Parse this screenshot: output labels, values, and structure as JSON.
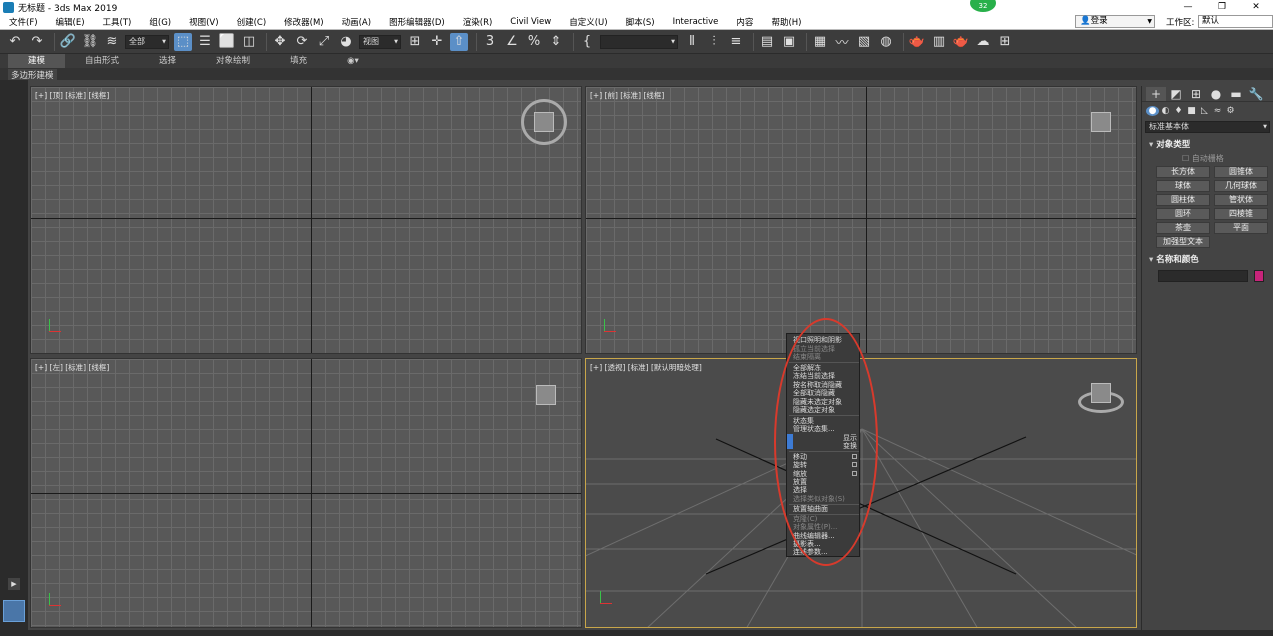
{
  "window": {
    "title": "无标题 - 3ds Max 2019",
    "notification_count": "32",
    "controls": [
      "—",
      "❐",
      "✕"
    ]
  },
  "menubar": {
    "items": [
      "文件(F)",
      "编辑(E)",
      "工具(T)",
      "组(G)",
      "视图(V)",
      "创建(C)",
      "修改器(M)",
      "动画(A)",
      "图形编辑器(D)",
      "渲染(R)",
      "Civil View",
      "自定义(U)",
      "脚本(S)",
      "Interactive",
      "内容",
      "帮助(H)"
    ],
    "login": "登录",
    "workspace_label": "工作区:",
    "workspace_value": "默认"
  },
  "toolbar": {
    "selection_filter": "全部",
    "ref_coord": "视图",
    "named_selection": ""
  },
  "ribbon": {
    "tabs": [
      "建模",
      "自由形式",
      "选择",
      "对象绘制",
      "填充"
    ],
    "sub_label": "多边形建模"
  },
  "viewports": {
    "top": "[+] [顶] [标准] [线框]",
    "front": "[+] [前] [标准] [线框]",
    "left": "[+] [左] [标准] [线框]",
    "perspective": "[+] [透视] [标准] [默认明暗处理]"
  },
  "command_panel": {
    "category": "标准基本体",
    "object_type_title": "对象类型",
    "autogrid": "自动栅格",
    "objects": [
      "长方体",
      "圆锥体",
      "球体",
      "几何球体",
      "圆柱体",
      "管状体",
      "圆环",
      "四棱锥",
      "茶壶",
      "平面",
      "加强型文本"
    ],
    "name_color_title": "名称和颜色"
  },
  "context_menu": {
    "items": [
      {
        "label": "视口照明和阴影",
        "dim": false
      },
      {
        "label": "孤立当前选择",
        "dim": true
      },
      {
        "label": "结束隔离",
        "dim": true
      },
      {
        "label": "全部解冻",
        "dim": false
      },
      {
        "label": "冻结当前选择",
        "dim": false
      },
      {
        "label": "按名称取消隐藏",
        "dim": false
      },
      {
        "label": "全部取消隐藏",
        "dim": false
      },
      {
        "label": "隐藏未选定对象",
        "dim": false
      },
      {
        "label": "隐藏选定对象",
        "dim": false
      },
      {
        "label": "状态集",
        "dim": false
      },
      {
        "label": "管理状态集...",
        "dim": false
      },
      {
        "label": "移动",
        "dim": false
      },
      {
        "label": "旋转",
        "dim": false
      },
      {
        "label": "缩放",
        "dim": false
      },
      {
        "label": "放置",
        "dim": false
      },
      {
        "label": "选择",
        "dim": false
      },
      {
        "label": "选择类似对象(S)",
        "dim": true
      },
      {
        "label": "放置轴曲面",
        "dim": false
      },
      {
        "label": "克隆(C)",
        "dim": true
      },
      {
        "label": "对象属性(P)...",
        "dim": true
      },
      {
        "label": "曲线编辑器...",
        "dim": false
      },
      {
        "label": "摄影表...",
        "dim": false
      },
      {
        "label": "连线参数...",
        "dim": false
      }
    ],
    "quad_labels": [
      "显示",
      "变换"
    ]
  }
}
